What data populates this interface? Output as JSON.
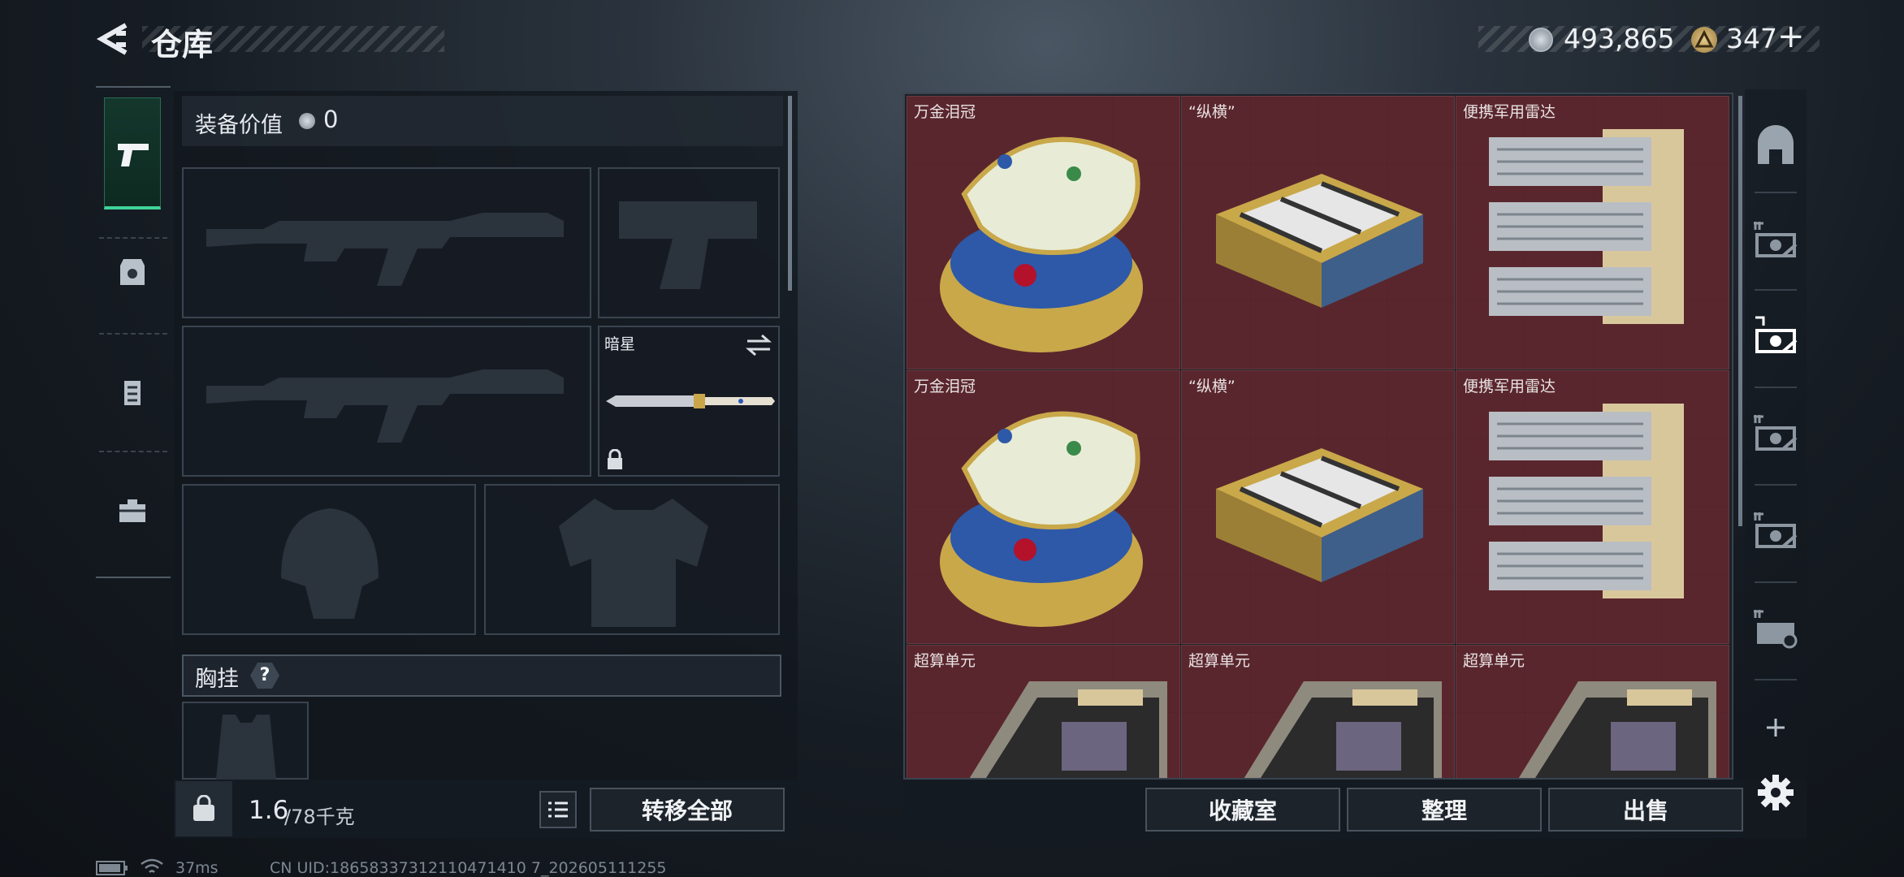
{
  "header": {
    "title": "仓库",
    "currency_1": "493,865",
    "currency_2": "347",
    "add": "+"
  },
  "equipment": {
    "value_label": "装备价值",
    "value": "0",
    "melee_name": "暗星",
    "chest_rig_label": "胸挂",
    "chest_rig_help": "?"
  },
  "storage": {
    "rows": [
      [
        "万金泪冠",
        "“纵横”",
        "便携军用雷达"
      ],
      [
        "万金泪冠",
        "“纵横”",
        "便携军用雷达"
      ],
      [
        "超算单元",
        "超算单元",
        "超算单元"
      ]
    ]
  },
  "footer": {
    "weight_current": "1.6",
    "weight_max": "/78千克",
    "transfer_all": "转移全部",
    "collection": "收藏室",
    "organize": "整理",
    "sell": "出售"
  },
  "status": {
    "ping": "37ms",
    "uid": "CN UID:18658337312110471410 7_202605111255"
  },
  "colors": {
    "accent": "#3fd39a",
    "item_bg": "#5a2a31"
  }
}
